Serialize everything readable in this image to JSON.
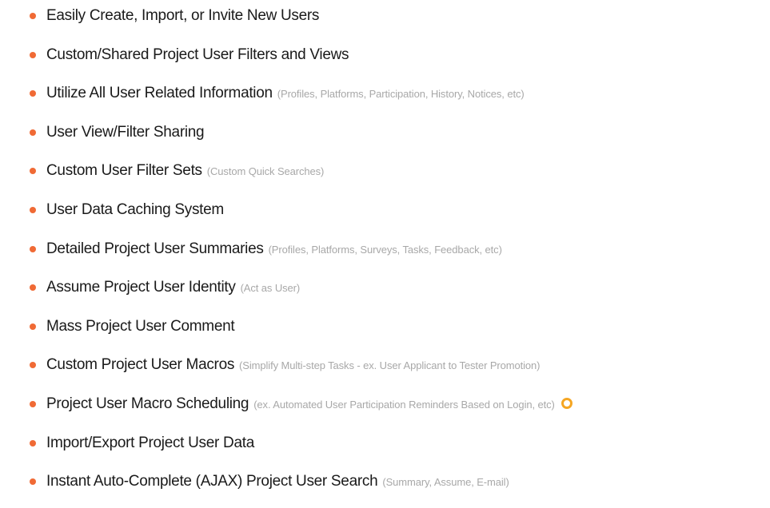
{
  "colors": {
    "bullet": "#f06a35",
    "title_text": "#1a1a1a",
    "note_text": "#a8a8a8",
    "ring_icon": "#f5a623"
  },
  "features": [
    {
      "title": "Easily Create, Import, or Invite New Users",
      "note": ""
    },
    {
      "title": "Custom/Shared Project User Filters and Views",
      "note": ""
    },
    {
      "title": "Utilize All User Related Information",
      "note": "(Profiles, Platforms, Participation, History, Notices, etc)"
    },
    {
      "title": "User View/Filter Sharing",
      "note": ""
    },
    {
      "title": "Custom User Filter Sets",
      "note": "(Custom Quick Searches)"
    },
    {
      "title": "User Data Caching System",
      "note": ""
    },
    {
      "title": "Detailed Project User Summaries",
      "note": "(Profiles, Platforms, Surveys, Tasks, Feedback, etc)"
    },
    {
      "title": "Assume Project User Identity",
      "note": "(Act as User)"
    },
    {
      "title": "Mass Project User Comment",
      "note": ""
    },
    {
      "title": "Custom Project User Macros",
      "note": "(Simplify Multi-step Tasks - ex. User Applicant to Tester Promotion)"
    },
    {
      "title": "Project User Macro Scheduling",
      "note": "(ex. Automated User Participation Reminders Based on Login, etc)",
      "icon": "ring-icon"
    },
    {
      "title": "Import/Export Project User Data",
      "note": ""
    },
    {
      "title": "Instant Auto-Complete (AJAX) Project User Search",
      "note": "(Summary, Assume, E-mail)"
    }
  ]
}
